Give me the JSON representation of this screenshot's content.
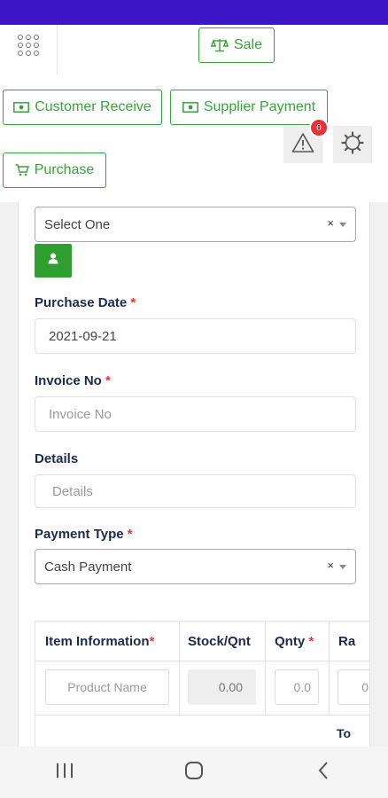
{
  "header": {
    "sale_label": "Sale",
    "customer_receive_label": "Customer Receive",
    "supplier_payment_label": "Supplier Payment",
    "purchase_label": "Purchase",
    "alert_count": "0"
  },
  "form": {
    "supplier": {
      "value": "Select One",
      "clear": "×"
    },
    "purchase_date": {
      "label": "Purchase Date",
      "required": "*",
      "value": "2021-09-21"
    },
    "invoice_no": {
      "label": "Invoice No",
      "required": "*",
      "placeholder": "Invoice No"
    },
    "details": {
      "label": "Details",
      "placeholder": "Details"
    },
    "payment_type": {
      "label": "Payment Type",
      "required": "*",
      "value": "Cash Payment",
      "clear": "×"
    }
  },
  "table": {
    "headers": {
      "item_information": "Item Information",
      "stock_qnt": "Stock/Qnt",
      "qnty": "Qnty",
      "rate": "Ra",
      "required": "*"
    },
    "row": {
      "product_placeholder": "Product Name",
      "stock_value": "0.00",
      "qnty_value": "0.0",
      "rate_value": "0"
    },
    "total_label": "To"
  },
  "colors": {
    "status_bar": "#3d16c7",
    "accent_green": "#37a33a",
    "badge_red": "#e8323a",
    "label_navy": "#1e2a4a"
  }
}
